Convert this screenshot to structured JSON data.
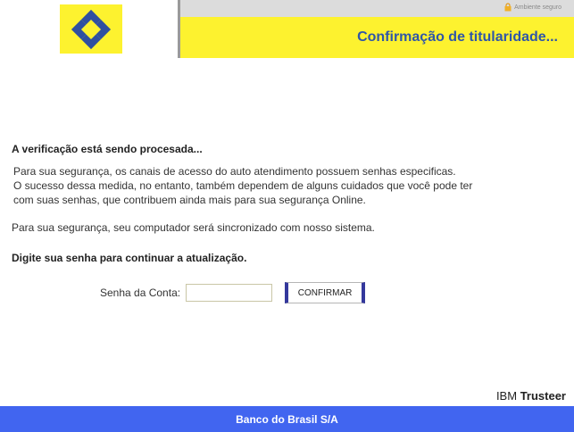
{
  "header": {
    "secure_label": "Ambiente seguro",
    "page_title": "Confirmação de titularidade..."
  },
  "content": {
    "status_heading": "A verificação está sendo procesada...",
    "paragraph_lines": [
      "Para sua segurança, os canais de acesso do auto atendimento possuem senhas especificas.",
      "O sucesso dessa medida, no entanto, também dependem de alguns cuidados que você pode ter",
      "com suas senhas, que contribuem ainda mais para sua segurança Online."
    ],
    "sync_text": "Para sua segurança, seu computador será sincronizado com nosso sistema.",
    "prompt_heading": "Digite sua senha para continuar a atualização."
  },
  "form": {
    "password_label": "Senha da Conta:",
    "password_value": "",
    "confirm_label": "CONFIRMAR"
  },
  "vendor": {
    "brand_light": "IBM",
    "brand_bold": "Trusteer"
  },
  "footer": {
    "text": "Banco do Brasil S/A"
  },
  "colors": {
    "brand_yellow": "#fdf22f",
    "brand_blue": "#2f56a8",
    "footer_blue": "#4165f0",
    "button_accent": "#34389c"
  },
  "icons": {
    "logo": "banco-do-brasil-logo",
    "lock": "lock-icon"
  }
}
